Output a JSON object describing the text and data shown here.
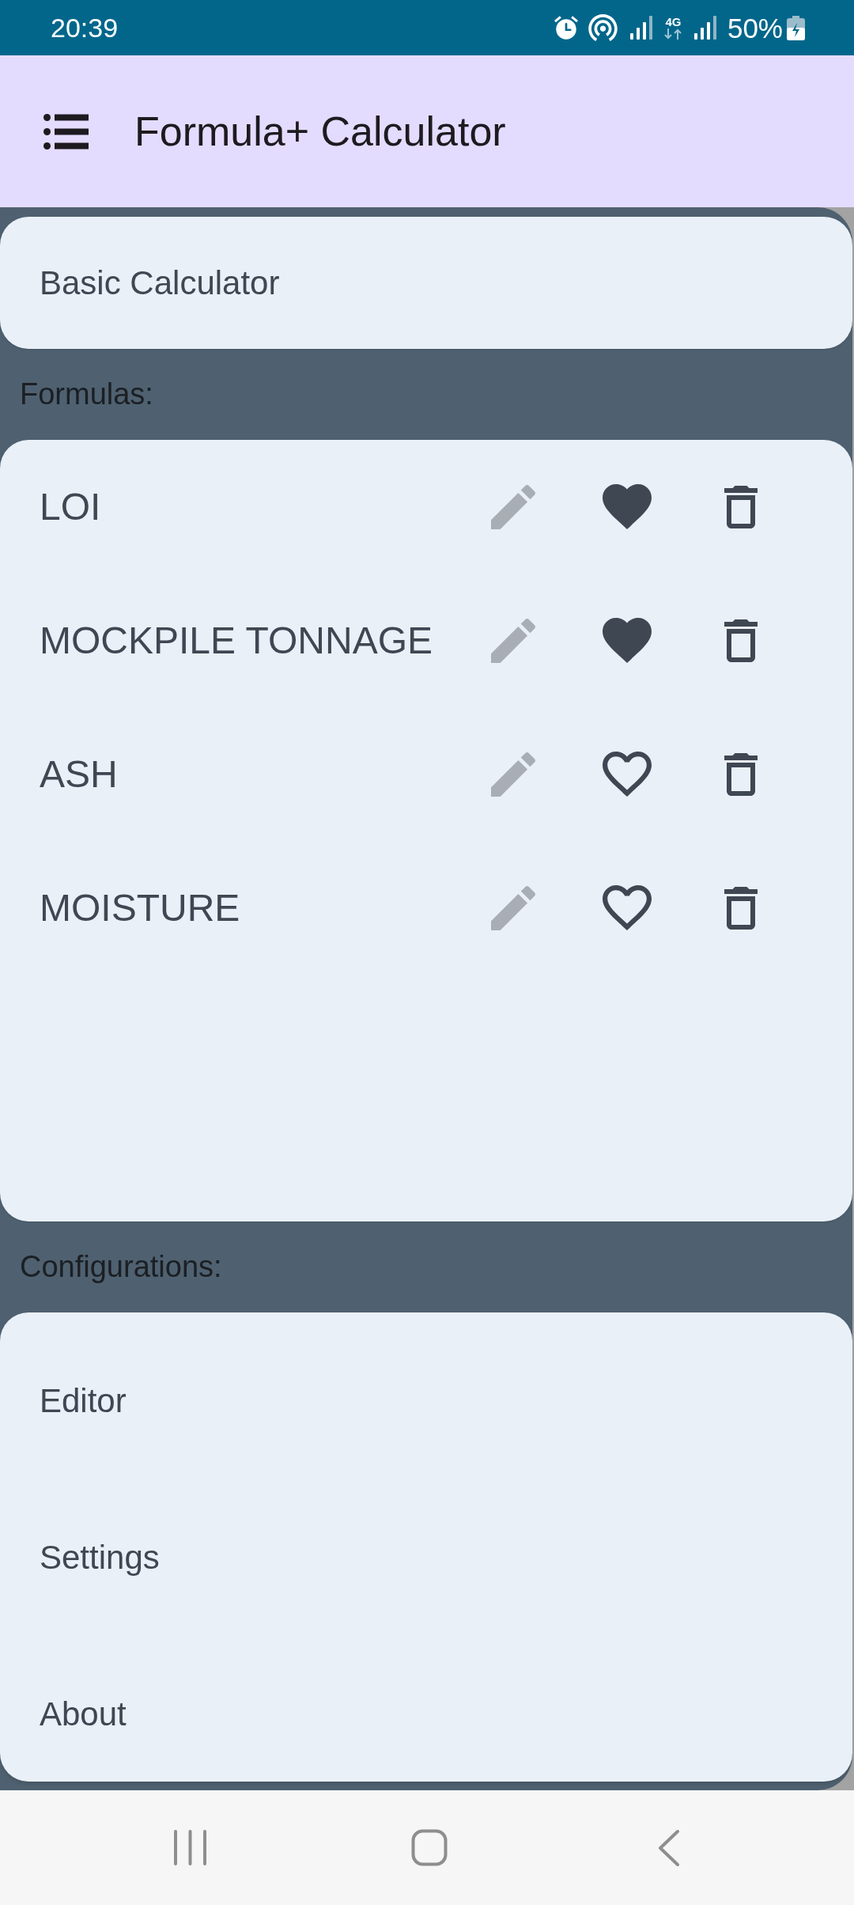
{
  "status_bar": {
    "time": "20:39",
    "network": "4G",
    "battery": "50%"
  },
  "app_bar": {
    "title": "Formula+ Calculator"
  },
  "drawer": {
    "basic_calculator": {
      "label": "Basic Calculator"
    },
    "formulas_heading": "Formulas:",
    "formulas": [
      {
        "name": "LOI",
        "favorite": true
      },
      {
        "name": "MOCKPILE TONNAGE",
        "favorite": true
      },
      {
        "name": "ASH",
        "favorite": false
      },
      {
        "name": "MOISTURE",
        "favorite": false
      }
    ],
    "configurations_heading": "Configurations:",
    "configurations": [
      {
        "label": "Editor"
      },
      {
        "label": "Settings"
      },
      {
        "label": "About"
      }
    ]
  }
}
